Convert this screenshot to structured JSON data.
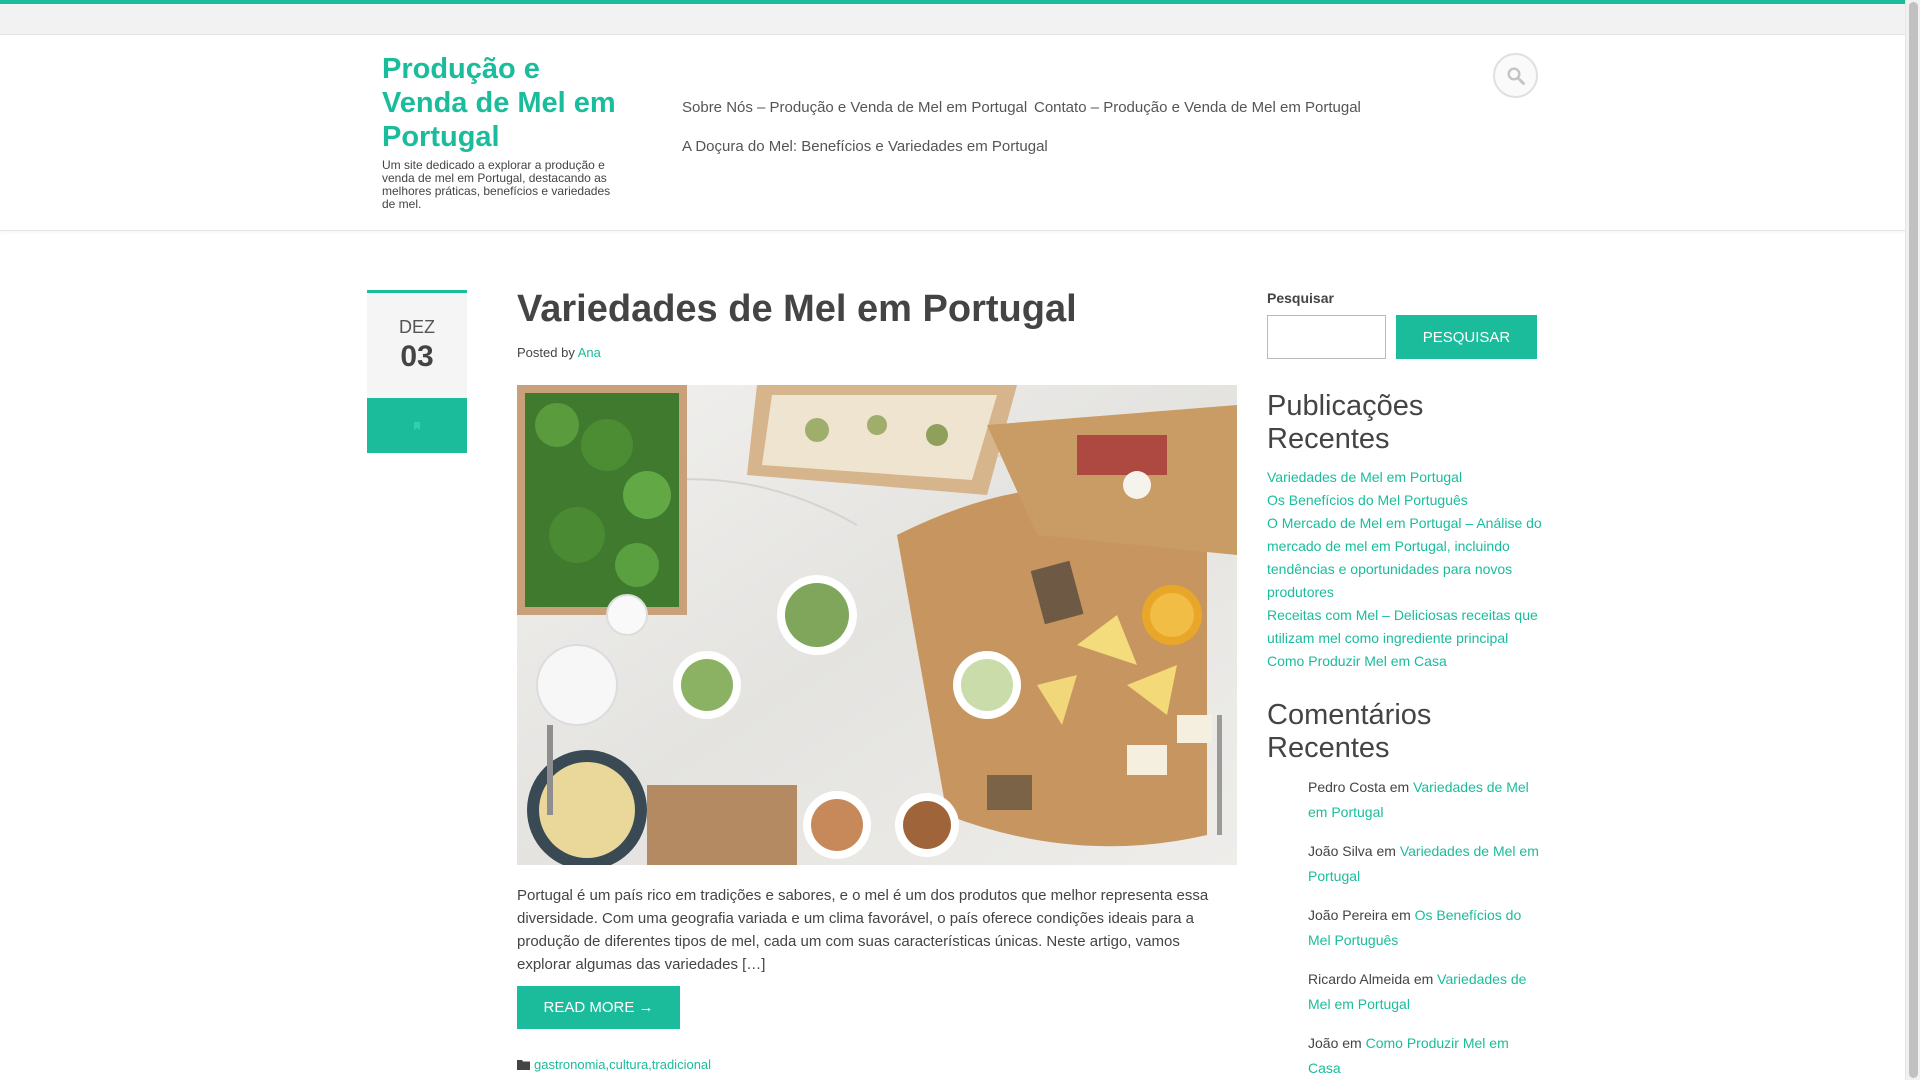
{
  "colors": {
    "accent": "#1abc9c",
    "text": "#444444",
    "topbar": "#f2f2f2"
  },
  "header": {
    "site_title": "Produção e Venda de Mel em Portugal",
    "site_description": "Um site dedicado a explorar a produção e venda de mel em Portugal, destacando as melhores práticas, benefícios e variedades de mel.",
    "nav": [
      {
        "label": "Sobre Nós – Produção e Venda de Mel em Portugal"
      },
      {
        "label": "Contato – Produção e Venda de Mel em Portugal"
      },
      {
        "label": "A Doçura do Mel: Benefícios e Variedades em Portugal"
      }
    ],
    "search_icon": "search-icon"
  },
  "post": {
    "date_month": "DEZ",
    "date_day": "03",
    "format_icon": "standard-post-icon",
    "title": "Variedades de Mel em Portugal",
    "posted_by_label": "Posted by",
    "author": "Ana",
    "image_icon": "food-board-image",
    "excerpt": "Portugal é um país rico em tradições e sabores, e o mel é um dos produtos que melhor representa essa diversidade. Com uma geografia variada e um clima favorável, o país oferece condições ideais para a produção de diferentes tipos de mel, cada um com suas características únicas. Neste artigo, vamos explorar algumas das variedades […]",
    "read_more": "READ MORE →",
    "categories_icon": "folder-icon",
    "categories": "gastronomia,cultura,tradicional"
  },
  "sidebar": {
    "search_label": "Pesquisar",
    "search_value": "",
    "search_button": "PESQUISAR",
    "recent_posts_title": "Publicações Recentes",
    "recent_posts": [
      {
        "title": "Variedades de Mel em Portugal"
      },
      {
        "title": "Os Benefícios do Mel Português"
      },
      {
        "title": "O Mercado de Mel em Portugal – Análise do mercado de mel em Portugal, incluindo tendências e oportunidades para novos produtores"
      },
      {
        "title": "Receitas com Mel – Deliciosas receitas que utilizam mel como ingrediente principal"
      },
      {
        "title": "Como Produzir Mel em Casa"
      }
    ],
    "recent_comments_title": "Comentários Recentes",
    "comment_connector": "em",
    "recent_comments": [
      {
        "author": "Pedro Costa",
        "post": "Variedades de Mel em Portugal"
      },
      {
        "author": "João Silva",
        "post": "Variedades de Mel em Portugal"
      },
      {
        "author": "João Pereira",
        "post": "Os Benefícios do Mel Português"
      },
      {
        "author": "Ricardo Almeida",
        "post": "Variedades de Mel em Portugal"
      },
      {
        "author": "João",
        "post": "Como Produzir Mel em Casa"
      }
    ]
  }
}
